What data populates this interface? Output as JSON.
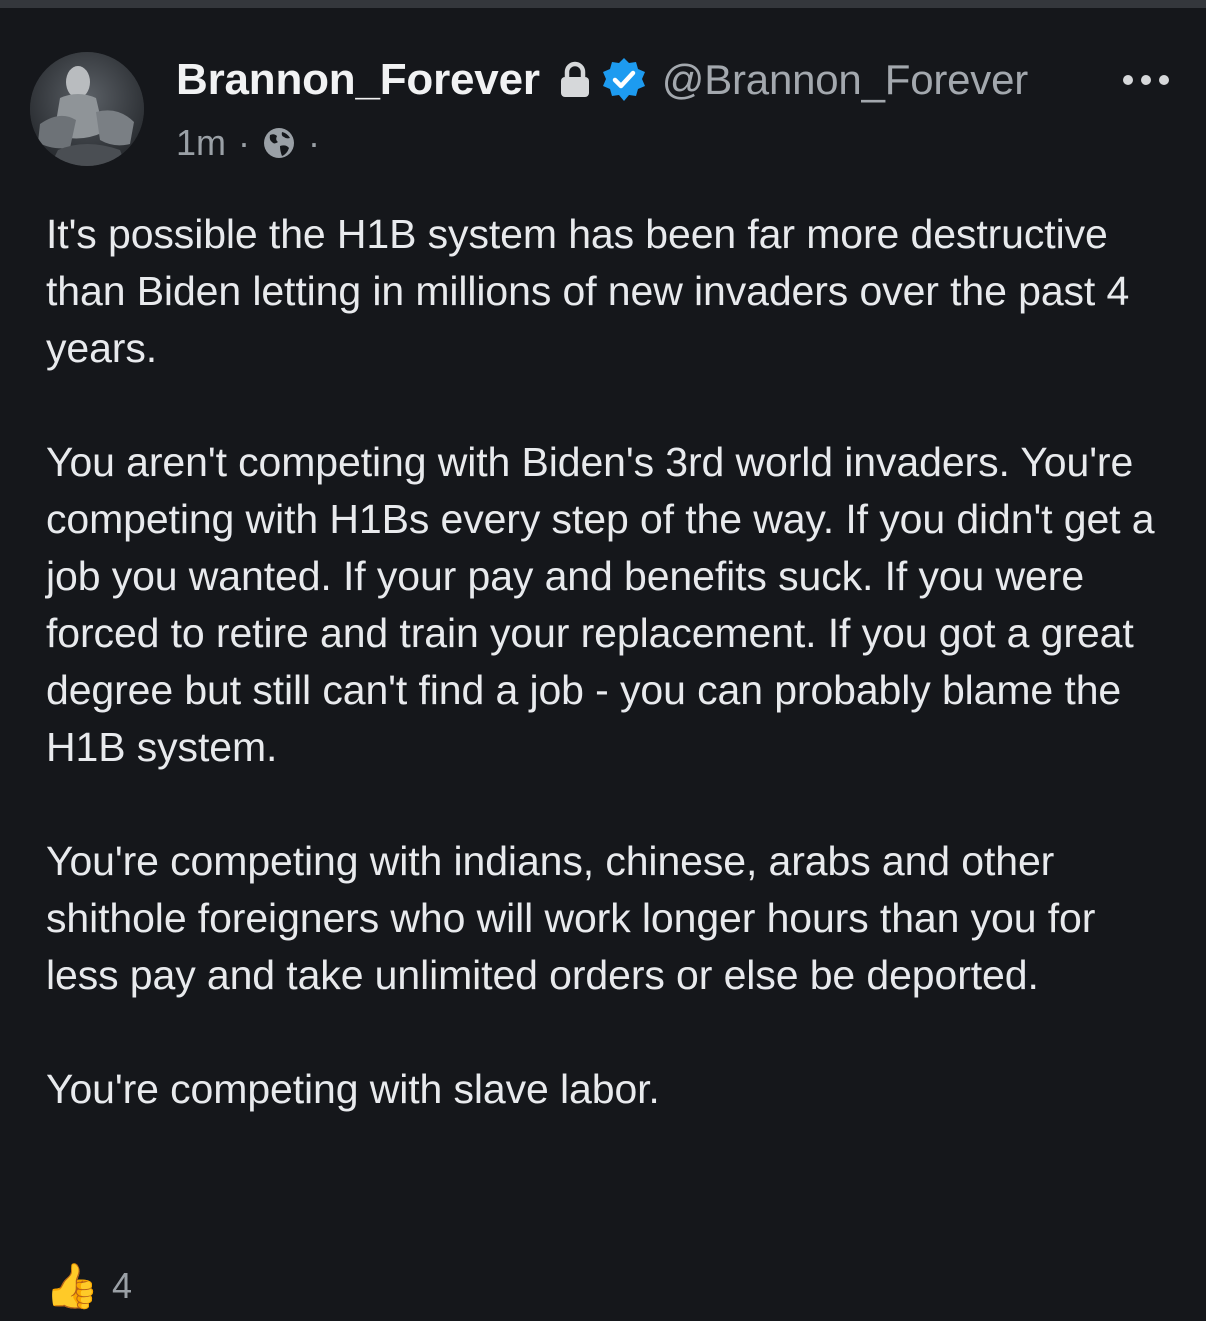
{
  "post": {
    "author": {
      "display_name": "Brannon_Forever",
      "handle": "@Brannon_Forever",
      "icons": [
        "lock-icon",
        "verified-badge-icon"
      ]
    },
    "timestamp": "1m",
    "separator": "·",
    "visibility_icon": "globe-icon",
    "paragraphs": [
      "It's possible the H1B system has been far more destructive than Biden letting in millions of new invaders over the past 4 years.",
      "You aren't competing with Biden's 3rd world invaders. You're competing with H1Bs every step of the way. If you didn't get a job you wanted. If your pay and benefits suck. If you were forced to retire and train your replacement. If you got a great degree but still can't find a job - you can probably blame the H1B system.",
      "You're competing with indians, chinese, arabs and other shithole foreigners who will work longer hours than you for less pay and take unlimited orders or else be deported.",
      "You're competing with slave labor."
    ],
    "reactions": {
      "icon": "thumbs-up-icon",
      "emoji": "👍",
      "count": "4"
    }
  },
  "colors": {
    "background": "#15171b",
    "text": "#e8eaed",
    "muted": "#9aa0a6",
    "verified": "#1d9bf0"
  }
}
